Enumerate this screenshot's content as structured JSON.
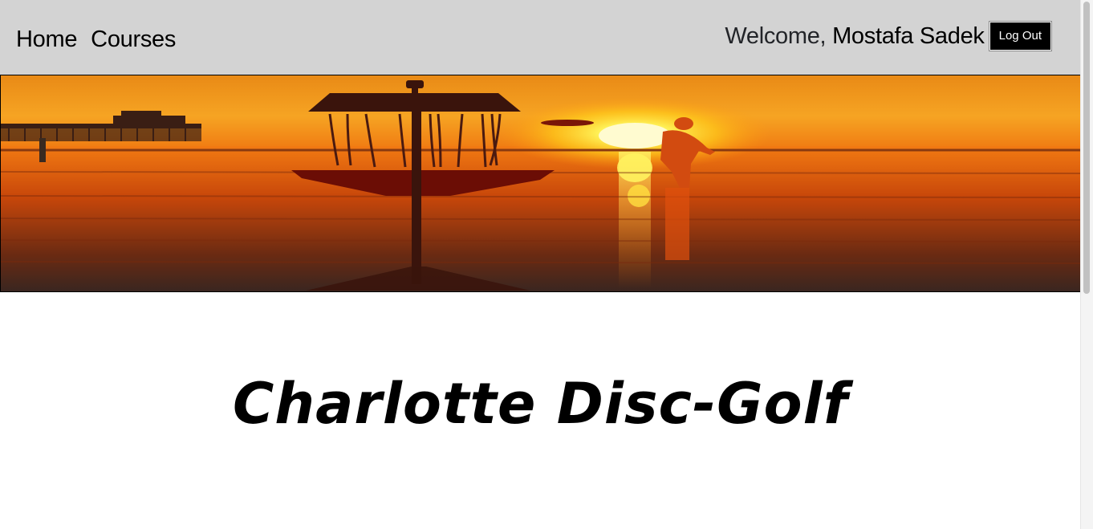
{
  "nav": {
    "home_label": "Home",
    "courses_label": "Courses",
    "welcome_prefix": "Welcome,",
    "user_name": "Mostafa Sadek",
    "logout_label": "Log Out"
  },
  "banner": {
    "icon": "disc-golf-sunset-banner"
  },
  "main": {
    "title": "Charlotte Disc-Golf"
  },
  "colors": {
    "navbar_bg": "#d3d3d3",
    "button_bg": "#000000",
    "button_text": "#ffffff"
  }
}
